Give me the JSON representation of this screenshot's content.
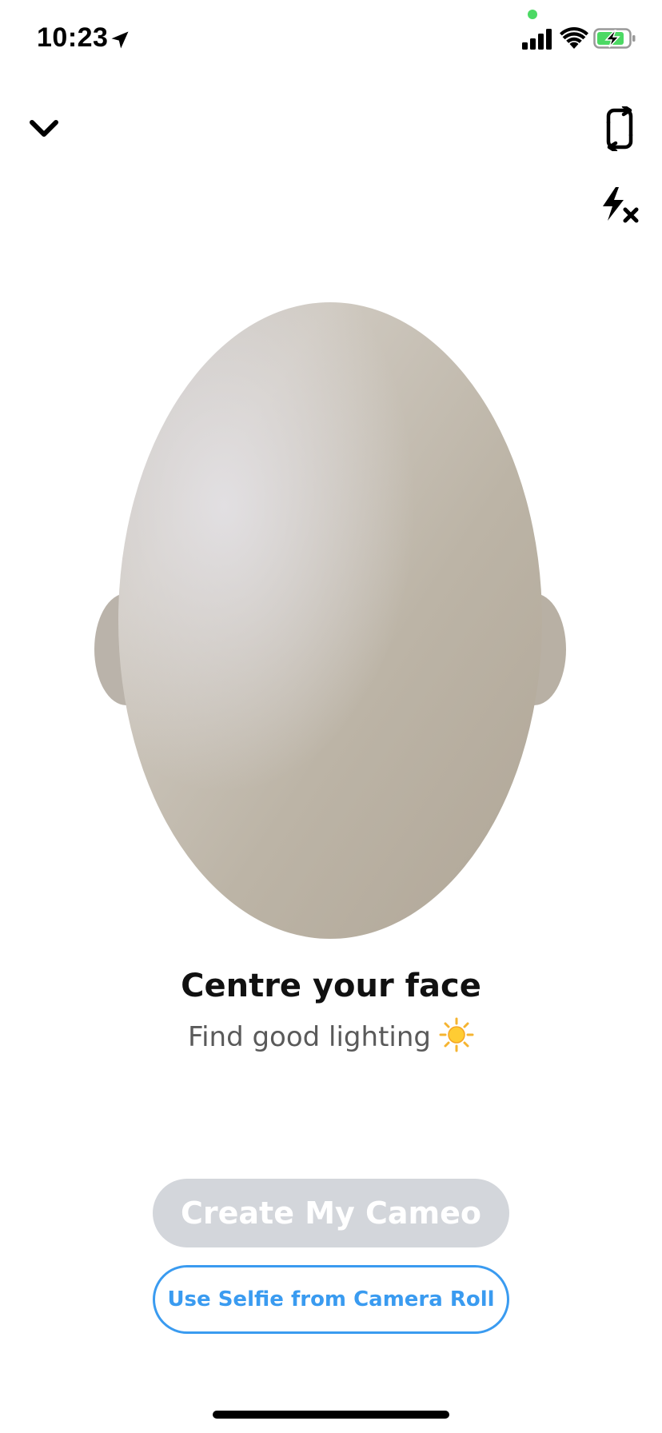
{
  "status_bar": {
    "time": "10:23",
    "location_icon": "location-arrow-icon",
    "signal_icon": "cellular-signal-icon",
    "wifi_icon": "wifi-icon",
    "battery_icon": "battery-charging-icon",
    "privacy_dot_color": "#4cd964",
    "battery_color": "#4cd964"
  },
  "toolbar": {
    "dismiss_icon": "chevron-down-icon",
    "flip_camera_icon": "flip-camera-icon",
    "flash_off_icon": "flash-off-icon"
  },
  "camera": {
    "face_outline_color": "#bcb4a8"
  },
  "instructions": {
    "title": "Centre your face",
    "subtitle": "Find good lighting",
    "subtitle_icon": "sun-icon"
  },
  "actions": {
    "create_label": "Create My Cameo",
    "create_color": "#d3d6db",
    "selfie_label": "Use Selfie from Camera Roll",
    "selfie_color": "#3a9bf0"
  }
}
